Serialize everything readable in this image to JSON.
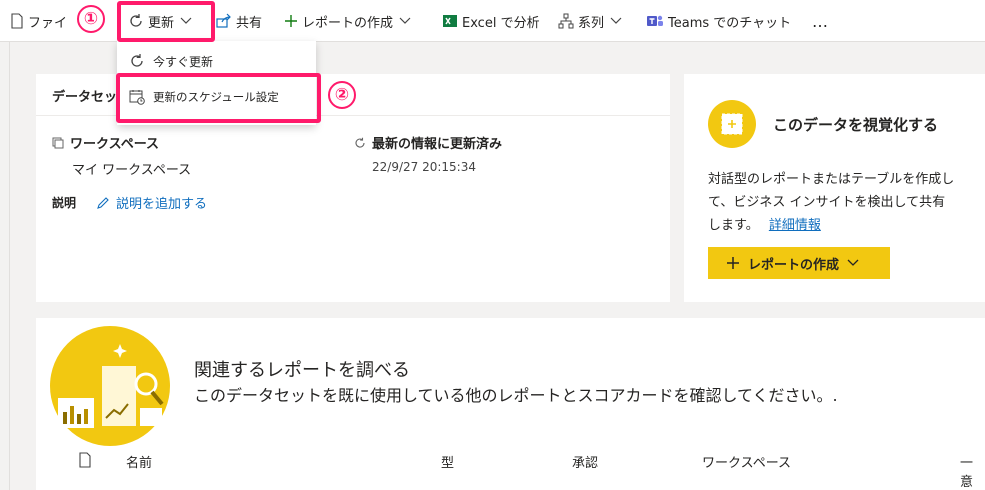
{
  "toolbar": {
    "file": "ファイ",
    "refresh": "更新",
    "share": "共有",
    "create_report": "レポートの作成",
    "excel": "Excel で分析",
    "lineage": "系列",
    "teams": "Teams でのチャット",
    "more": "…"
  },
  "dropdown": {
    "refresh_now": "今すぐ更新",
    "schedule": "更新のスケジュール設定"
  },
  "annotations": {
    "one": "①",
    "two": "②"
  },
  "dataset": {
    "title": "データセッ",
    "workspace_label": "ワークスペース",
    "workspace_value": "マイ ワークスペース",
    "refresh_label": "最新の情報に更新済み",
    "refresh_value": "22/9/27 20:15:34",
    "description_label": "説明",
    "add_description": "説明を追加する"
  },
  "visualize": {
    "title": "このデータを視覚化する",
    "body_1": "対話型のレポートまたはテーブルを作成し",
    "body_2": "て、ビジネス インサイトを検出して共有",
    "body_3": "します。",
    "details_link": "詳細情報",
    "button": "レポートの作成"
  },
  "related": {
    "title": "関連するレポートを調べる",
    "subtitle": "このデータセットを既に使用している他のレポートとスコアカードを確認してください。.",
    "columns": [
      "名前",
      "型",
      "承認",
      "ワークスペース",
      "一意"
    ]
  },
  "colors": {
    "accent_yellow": "#f2c811",
    "highlight": "#ff1a6b",
    "link": "#106ebe"
  }
}
